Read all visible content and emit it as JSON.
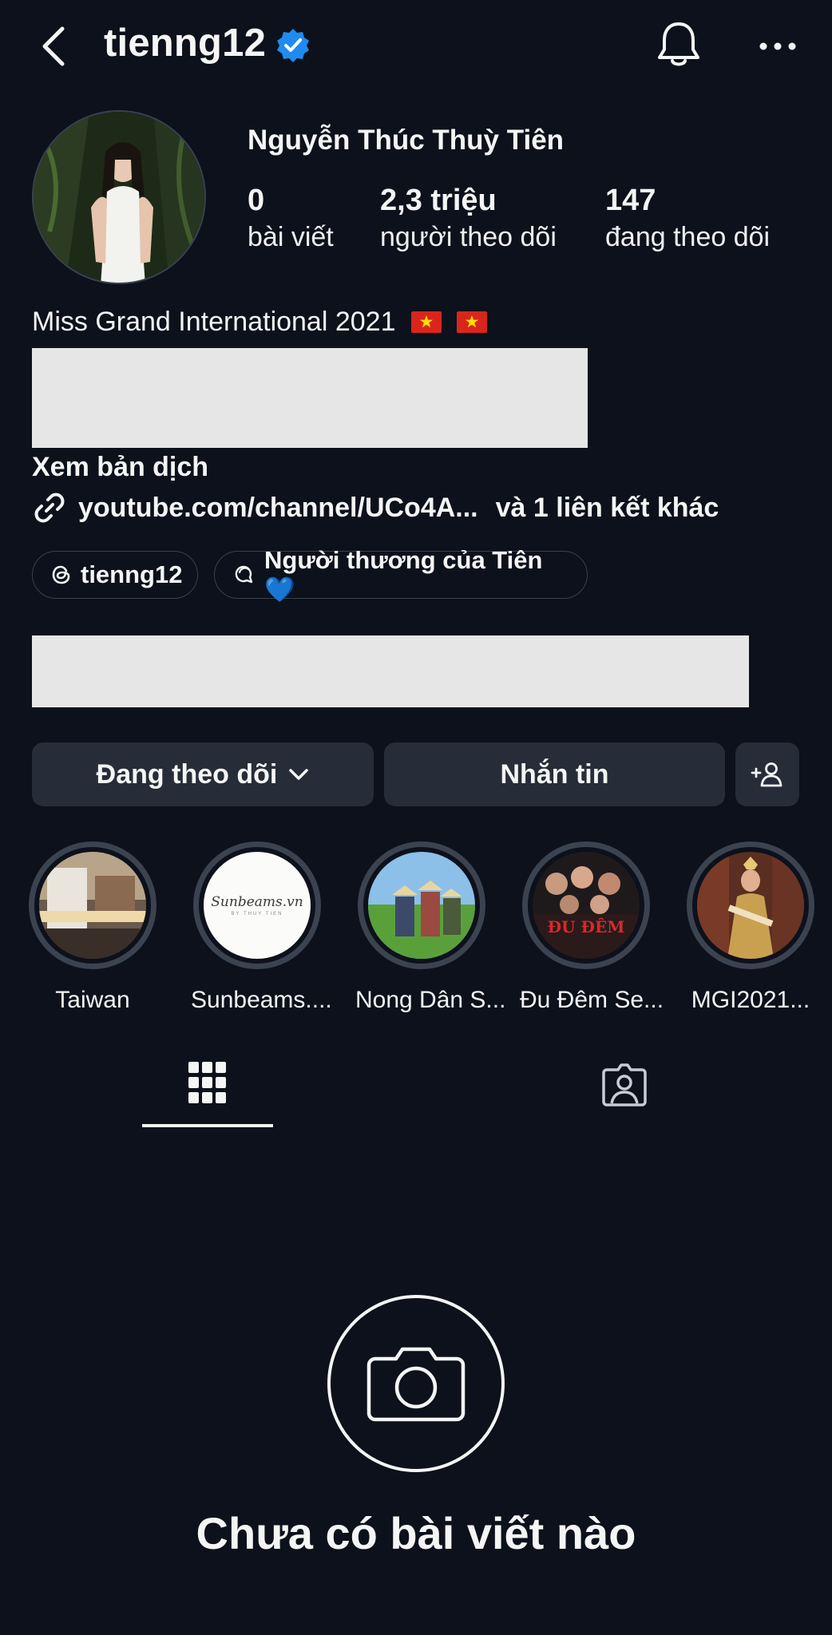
{
  "header": {
    "username": "tienng12",
    "icons": [
      "back-arrow-icon",
      "verified-badge-icon",
      "bell-icon",
      "more-icon"
    ]
  },
  "profile": {
    "full_name": "Nguyễn Thúc Thuỳ Tiên",
    "stats": {
      "posts": {
        "value": "0",
        "label": "bài viết"
      },
      "followers": {
        "value": "2,3 triệu",
        "label": "người theo dõi"
      },
      "following": {
        "value": "147",
        "label": "đang theo dõi"
      }
    },
    "bio": "Miss Grand International 2021",
    "translate_label": "Xem bản dịch",
    "link": {
      "url": "youtube.com/channel/UCo4A...",
      "extra": "và 1 liên kết khác"
    },
    "chips": {
      "threads": "tienng12",
      "channel": "Người thương của Tiên 💙"
    }
  },
  "actions": {
    "follow": "Đang theo dõi",
    "message": "Nhắn tin"
  },
  "highlights": [
    {
      "label": "Taiwan"
    },
    {
      "label": "Sunbeams...."
    },
    {
      "label": "Nong Dân S..."
    },
    {
      "label": "Đu Đêm Se..."
    },
    {
      "label": "MGI2021..."
    }
  ],
  "highlight_thumb_texts": {
    "sunbeams": "Sunbeams.vn",
    "sunbeams_sub": "BY THUY TIEN",
    "du_dem": "ĐU ĐÊM"
  },
  "empty_state": {
    "message": "Chưa có bài viết nào"
  },
  "colors": {
    "background": "#0c111b",
    "button": "#262d38",
    "verified": "#1f8bf0",
    "highlight_ring": "#3b4350"
  }
}
